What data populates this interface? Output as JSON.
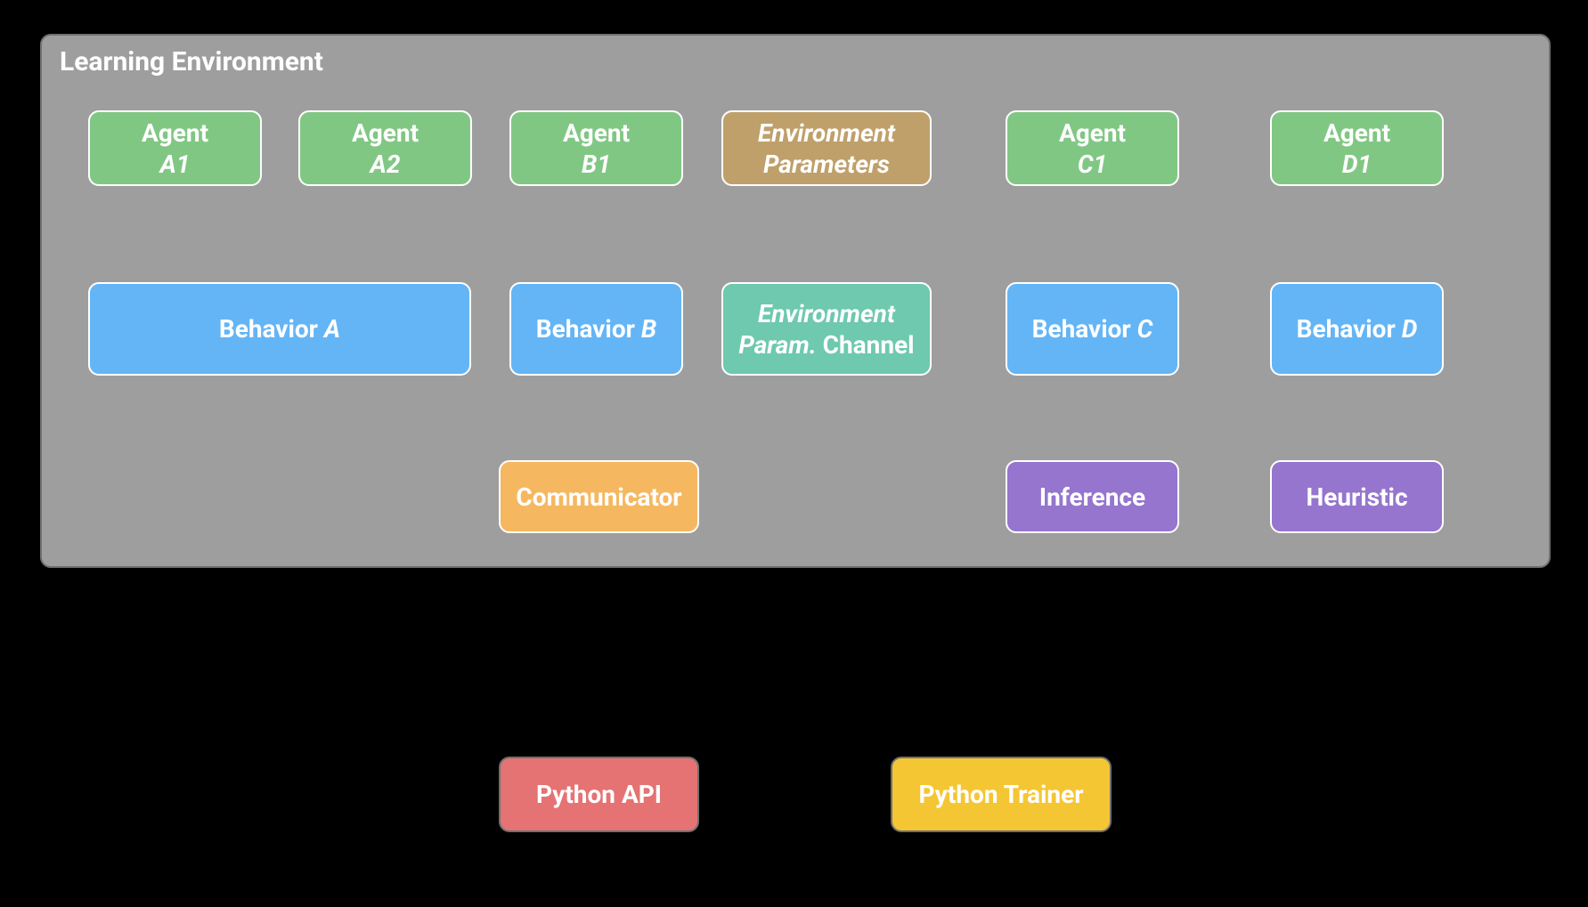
{
  "diagram": {
    "title": "Learning Environment",
    "nodes": {
      "agent_a1": {
        "line1": "Agent",
        "line2": "A1"
      },
      "agent_a2": {
        "line1": "Agent",
        "line2": "A2"
      },
      "agent_b1": {
        "line1": "Agent",
        "line2": "B1"
      },
      "env_params": {
        "line1": "Environment",
        "line2": "Parameters"
      },
      "agent_c1": {
        "line1": "Agent",
        "line2": "C1"
      },
      "agent_d1": {
        "line1": "Agent",
        "line2": "D1"
      },
      "behavior_a": {
        "prefix": "Behavior ",
        "suffix": "A"
      },
      "behavior_b": {
        "prefix": "Behavior ",
        "suffix": "B"
      },
      "env_param_channel": {
        "line1": "Environment",
        "line2_prefix": "Param.",
        "line2_suffix": " Channel"
      },
      "behavior_c": {
        "prefix": "Behavior ",
        "suffix": "C"
      },
      "behavior_d": {
        "prefix": "Behavior ",
        "suffix": "D"
      },
      "communicator": "Communicator",
      "inference": "Inference",
      "heuristic": "Heuristic",
      "python_api": "Python API",
      "python_trainer": "Python Trainer"
    },
    "colors": {
      "agent": "#81c784",
      "behavior": "#64b5f6",
      "env_params": "#bfa06a",
      "channel": "#6ec9ae",
      "communicator": "#f5b860",
      "inference": "#9575cd",
      "python_api": "#e57373",
      "python_trainer": "#f5c633",
      "panel": "#9e9e9e",
      "arrow": "#ffffff",
      "black_link": "#000000"
    },
    "edges": [
      {
        "from": "agent_a1",
        "to": "behavior_a",
        "style": "white-double"
      },
      {
        "from": "agent_a2",
        "to": "behavior_a",
        "style": "white-double"
      },
      {
        "from": "agent_b1",
        "to": "behavior_b",
        "style": "white-double"
      },
      {
        "from": "env_params",
        "to": "env_param_channel",
        "style": "white-double"
      },
      {
        "from": "agent_c1",
        "to": "behavior_c",
        "style": "white-double"
      },
      {
        "from": "agent_d1",
        "to": "behavior_d",
        "style": "white-double"
      },
      {
        "from": "behavior_a",
        "to": "communicator",
        "style": "white-double-elbow"
      },
      {
        "from": "behavior_b",
        "to": "communicator",
        "style": "white-double"
      },
      {
        "from": "env_param_channel",
        "to": "communicator",
        "style": "white-double-elbow"
      },
      {
        "from": "behavior_c",
        "to": "inference",
        "style": "white-double"
      },
      {
        "from": "behavior_d",
        "to": "heuristic",
        "style": "white-double"
      },
      {
        "from": "communicator",
        "to": "python_api",
        "style": "black-lollipop"
      },
      {
        "from": "python_api",
        "to": "python_trainer",
        "style": "black-lollipop"
      }
    ]
  }
}
